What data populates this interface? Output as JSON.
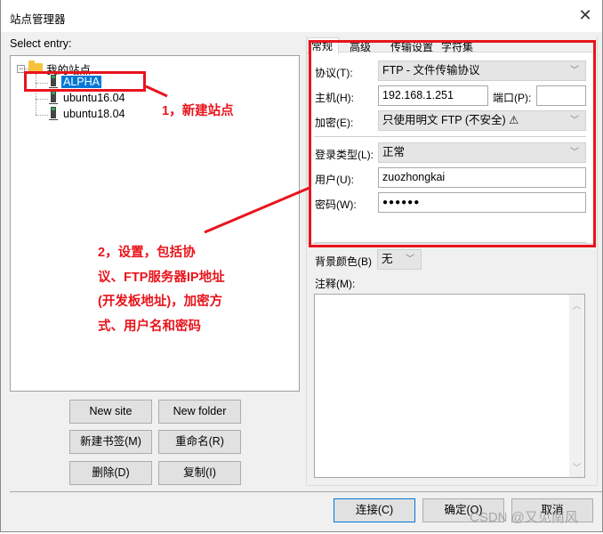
{
  "window": {
    "title": "站点管理器",
    "close_icon": "close-icon"
  },
  "left": {
    "select_entry_label": "Select entry:",
    "tree": {
      "root": {
        "label": "我的站点",
        "icon": "folder-icon",
        "expanded": true
      },
      "sites": [
        {
          "label": "ALPHA",
          "icon": "server-icon",
          "selected": true
        },
        {
          "label": "ubuntu16.04",
          "icon": "server-icon",
          "selected": false
        },
        {
          "label": "ubuntu18.04",
          "icon": "server-icon",
          "selected": false
        }
      ]
    },
    "buttons": {
      "new_site": "New site",
      "new_folder": "New folder",
      "new_bookmark": "新建书签(M)",
      "rename": "重命名(R)",
      "delete": "删除(D)",
      "copy": "复制(I)"
    }
  },
  "right": {
    "tabs": [
      {
        "label": "常规",
        "active": true
      },
      {
        "label": "高级",
        "active": false
      },
      {
        "label": "传输设置",
        "active": false
      },
      {
        "label": "字符集",
        "active": false
      }
    ],
    "general": {
      "protocol_label": "协议(T):",
      "protocol_value": "FTP - 文件传输协议",
      "host_label": "主机(H):",
      "host_value": "192.168.1.251",
      "port_label": "端口(P):",
      "port_value": "",
      "encryption_label": "加密(E):",
      "encryption_value": "只使用明文 FTP (不安全) ⚠",
      "logon_type_label": "登录类型(L):",
      "logon_type_value": "正常",
      "user_label": "用户(U):",
      "user_value": "zuozhongkai",
      "password_label": "密码(W):",
      "password_value": "●●●●●●"
    },
    "background_color_label": "背景颜色(B)",
    "background_color_value": "无",
    "comments_label": "注释(M):",
    "comments_value": ""
  },
  "footer": {
    "connect": "连接(C)",
    "ok": "确定(O)",
    "cancel": "取消"
  },
  "annotations": {
    "step1": "1，新建站点",
    "step2_lines": [
      "2，设置，包括协",
      "议、FTP服务器IP地址",
      "(开发板地址)，加密方",
      "式、用户名和密码"
    ],
    "color": "#e8141c"
  },
  "watermark": "CSDN @又见南风"
}
